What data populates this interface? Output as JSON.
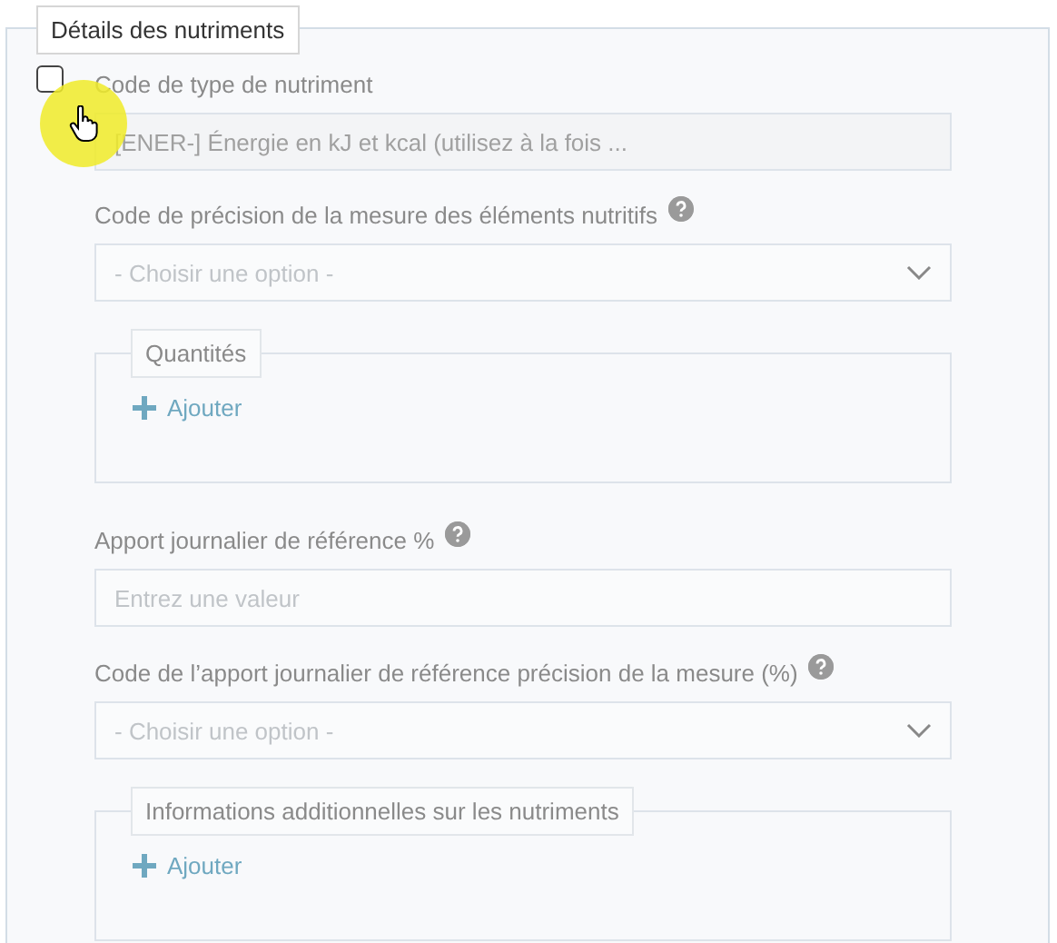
{
  "section": {
    "legend": "Détails des nutriments",
    "checkbox": {
      "checked": false
    },
    "items": [
      {
        "kind": "text",
        "label": "Code de type de nutriment",
        "help": false,
        "value": "[ENER-] Énergie en kJ et kcal (utilisez à la fois ...",
        "disabled": true
      },
      {
        "kind": "select",
        "label": "Code de précision de la mesure des éléments nutritifs",
        "help": true,
        "placeholder": "- Choisir une option -"
      },
      {
        "kind": "group",
        "legend": "Quantités",
        "action": "Ajouter"
      },
      {
        "kind": "input",
        "label": "Apport journalier de référence %",
        "help": true,
        "placeholder": "Entrez une valeur"
      },
      {
        "kind": "select",
        "label": "Code de l’apport journalier de référence précision de la mesure (%)",
        "help": true,
        "placeholder": "- Choisir une option -"
      },
      {
        "kind": "group",
        "legend": "Informations additionnelles sur les nutriments",
        "action": "Ajouter"
      }
    ]
  }
}
